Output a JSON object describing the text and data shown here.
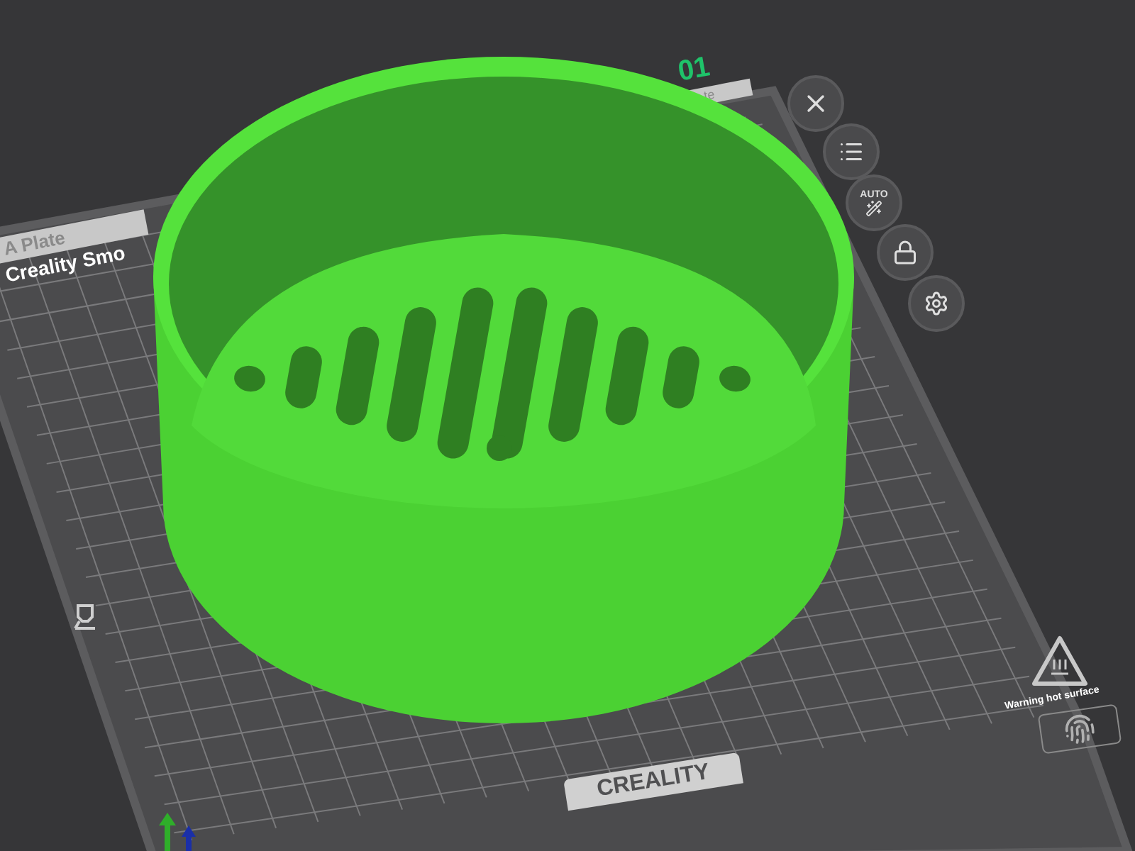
{
  "plate_number": "01",
  "plate_labels": [
    {
      "text": "A Plate"
    },
    {
      "text": "te"
    }
  ],
  "printer_name": "Creality Smo",
  "brand": "CREALITY",
  "warning": "Warning hot surface",
  "tools": [
    {
      "kind": "close"
    },
    {
      "kind": "list"
    },
    {
      "kind": "auto",
      "label": "AUTO"
    },
    {
      "kind": "lock"
    },
    {
      "kind": "settings"
    }
  ]
}
